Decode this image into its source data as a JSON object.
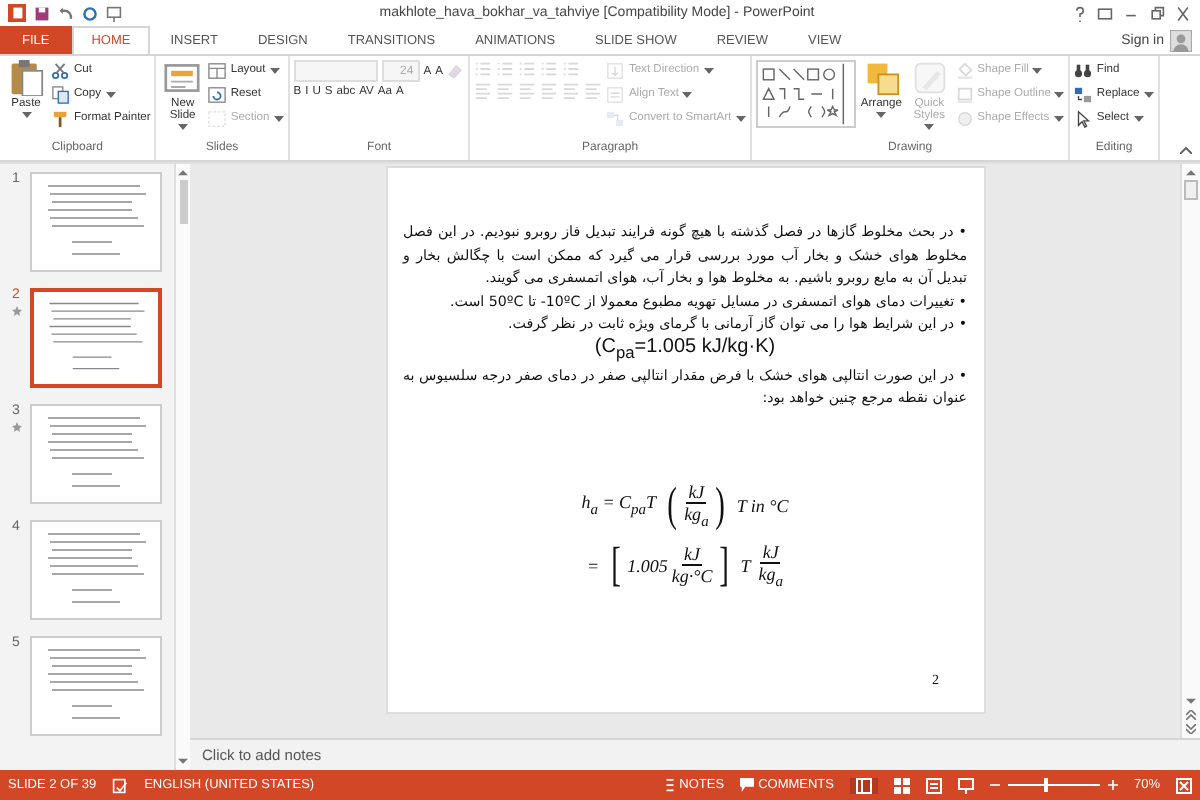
{
  "window": {
    "title": "makhlote_hava_bokhar_va_tahviye [Compatibility Mode] - PowerPoint",
    "sign_in": "Sign in"
  },
  "tabs": [
    {
      "label": "FILE",
      "kind": "file",
      "selected": false
    },
    {
      "label": "HOME",
      "kind": "tab",
      "selected": true
    },
    {
      "label": "INSERT",
      "kind": "tab",
      "selected": false
    },
    {
      "label": "DESIGN",
      "kind": "tab",
      "selected": false
    },
    {
      "label": "TRANSITIONS",
      "kind": "tab",
      "selected": false
    },
    {
      "label": "ANIMATIONS",
      "kind": "tab",
      "selected": false
    },
    {
      "label": "SLIDE SHOW",
      "kind": "tab",
      "selected": false
    },
    {
      "label": "REVIEW",
      "kind": "tab",
      "selected": false
    },
    {
      "label": "VIEW",
      "kind": "tab",
      "selected": false
    }
  ],
  "ribbon": {
    "groups": [
      {
        "label": "Clipboard",
        "columns": [
          [
            [
              {
                "kind": "large",
                "label": "Paste",
                "dropdown": true,
                "disabled": false
              }
            ]
          ],
          [
            [
              {
                "kind": "small",
                "label": "Cut",
                "dropdown": false,
                "disabled": false
              }
            ],
            [
              {
                "kind": "small",
                "label": "Copy",
                "dropdown": true,
                "disabled": false
              }
            ],
            [
              {
                "kind": "small",
                "label": "Format Painter",
                "dropdown": false,
                "disabled": false
              }
            ]
          ]
        ]
      },
      {
        "label": "Slides",
        "columns": [
          [
            [
              {
                "kind": "large",
                "label": "New Slide",
                "dropdown": true,
                "disabled": false
              }
            ]
          ],
          [
            [
              {
                "kind": "small",
                "label": "Layout",
                "dropdown": true,
                "disabled": false
              }
            ],
            [
              {
                "kind": "small",
                "label": "Reset",
                "dropdown": false,
                "disabled": false
              }
            ],
            [
              {
                "kind": "small",
                "label": "Section",
                "dropdown": true,
                "disabled": true
              }
            ]
          ]
        ]
      },
      {
        "label": "Font",
        "columns": [
          [
            [
              {
                "kind": "field",
                "disabled": true
              },
              {
                "kind": "field",
                "value": "24",
                "disabled": true
              },
              {
                "kind": "glyph",
                "label": "A",
                "disabled": true
              },
              {
                "kind": "glyph",
                "label": "A",
                "disabled": true
              },
              {
                "kind": "icon",
                "disabled": true
              }
            ],
            [
              {
                "kind": "glyph",
                "label": "B",
                "disabled": true
              },
              {
                "kind": "glyph",
                "label": "I",
                "disabled": true
              },
              {
                "kind": "glyph",
                "label": "U",
                "disabled": true
              },
              {
                "kind": "glyph",
                "label": "S",
                "disabled": true
              },
              {
                "kind": "glyph",
                "label": "abc",
                "disabled": true
              },
              {
                "kind": "glyph",
                "label": "AV",
                "disabled": true
              },
              {
                "kind": "glyph",
                "label": "Aa",
                "disabled": true
              },
              {
                "kind": "glyph",
                "label": "A",
                "disabled": true
              }
            ]
          ]
        ]
      },
      {
        "label": "Paragraph",
        "columns": [
          [
            [
              {
                "kind": "icon",
                "disabled": true
              },
              {
                "kind": "icon",
                "disabled": true
              },
              {
                "kind": "icon",
                "disabled": true
              },
              {
                "kind": "icon",
                "disabled": true
              },
              {
                "kind": "icon",
                "disabled": true
              }
            ],
            [
              {
                "kind": "icon",
                "disabled": true
              },
              {
                "kind": "icon",
                "disabled": true
              },
              {
                "kind": "icon",
                "disabled": true
              },
              {
                "kind": "icon",
                "disabled": true
              },
              {
                "kind": "icon",
                "disabled": true
              },
              {
                "kind": "icon",
                "disabled": true
              }
            ]
          ],
          [
            [
              {
                "kind": "small",
                "label": "Text Direction",
                "dropdown": true,
                "disabled": true
              }
            ],
            [
              {
                "kind": "small",
                "label": "Align Text",
                "dropdown": true,
                "disabled": true
              }
            ],
            [
              {
                "kind": "small",
                "label": "Convert to SmartArt",
                "dropdown": true,
                "disabled": true
              }
            ]
          ]
        ]
      },
      {
        "label": "Drawing",
        "columns": [
          [
            [
              {
                "kind": "gallery",
                "disabled": false
              }
            ]
          ],
          [
            [
              {
                "kind": "large",
                "label": "Arrange",
                "dropdown": true,
                "disabled": false
              }
            ]
          ],
          [
            [
              {
                "kind": "large",
                "label": "Quick Styles",
                "dropdown": true,
                "disabled": true
              }
            ]
          ],
          [
            [
              {
                "kind": "small",
                "label": "Shape Fill",
                "dropdown": true,
                "disabled": true
              }
            ],
            [
              {
                "kind": "small",
                "label": "Shape Outline",
                "dropdown": true,
                "disabled": true
              }
            ],
            [
              {
                "kind": "small",
                "label": "Shape Effects",
                "dropdown": true,
                "disabled": true
              }
            ]
          ]
        ]
      },
      {
        "label": "Editing",
        "columns": [
          [
            [
              {
                "kind": "small",
                "label": "Find",
                "dropdown": false,
                "disabled": false
              }
            ],
            [
              {
                "kind": "small",
                "label": "Replace",
                "dropdown": true,
                "disabled": false
              }
            ],
            [
              {
                "kind": "small",
                "label": "Select",
                "dropdown": true,
                "disabled": false
              }
            ]
          ]
        ]
      }
    ]
  },
  "thumbnails": [
    {
      "number": "1",
      "selected": false,
      "animated": false
    },
    {
      "number": "2",
      "selected": true,
      "animated": true
    },
    {
      "number": "3",
      "selected": false,
      "animated": true
    },
    {
      "number": "4",
      "selected": false,
      "animated": false
    },
    {
      "number": "5",
      "selected": false,
      "animated": false
    }
  ],
  "slide": {
    "paragraphs": [
      {
        "kind": "bullet",
        "text": "• در بحث مخلوط گازها در فصل گذشته با هیچ گونه فرایند تبدیل فاز روبرو نبودیم. در این فصل مخلوط هوای خشک و بخار آب مورد بررسی قرار می گیرد که ممکن است با چگالش بخار و تبدیل آن به مایع روبرو باشیم. به مخلوط هوا و بخار آب، هوای اتمسفری می گویند."
      },
      {
        "kind": "bullet",
        "text": "• تغییرات دمای هوای اتمسفری در مسایل تهویه مطبوع معمولا از ‎-10ºC‏ تا 50ºC است."
      },
      {
        "kind": "bullet",
        "text": "• در این شرایط هوا را می توان گاز آرمانی با گرمای ویژه ثابت در نظر گرفت."
      },
      {
        "kind": "center",
        "text": "(C$_{pa}$=1.005 kJ/kg·K)"
      },
      {
        "kind": "bullet",
        "text": "• در این صورت انتالپی هوای خشک با فرض مقدار انتالپی صفر در دمای صفر درجه سلسیوس به عنوان نقطه مرجع چنین خواهد بود:"
      }
    ],
    "equations": [
      {
        "parts": [
          {
            "kind": "text",
            "text": "h$_{a}$ = C$_{pa}$T"
          },
          {
            "kind": "group",
            "open": "(",
            "close": ")",
            "parts": [
              {
                "kind": "frac",
                "num": "kJ",
                "den": "kg$_{a}$"
              }
            ]
          },
          {
            "kind": "text",
            "text": "T in °C"
          }
        ]
      },
      {
        "parts": [
          {
            "kind": "text",
            "text": "="
          },
          {
            "kind": "group",
            "open": "[",
            "close": "]",
            "parts": [
              {
                "kind": "text",
                "text": "1.005"
              },
              {
                "kind": "frac",
                "num": "kJ",
                "den": "kg·°C"
              }
            ]
          },
          {
            "kind": "text",
            "text": "T"
          },
          {
            "kind": "frac",
            "num": "kJ",
            "den": "kg$_{a}$"
          }
        ]
      }
    ],
    "page_number": "2"
  },
  "notes": {
    "placeholder": "Click to add notes"
  },
  "status_bar": {
    "slide": "SLIDE 2 OF 39",
    "language": "ENGLISH (UNITED STATES)",
    "notes": "NOTES",
    "comments": "COMMENTS",
    "zoom": "70%",
    "zoom_level": {
      "level": 0.4
    }
  }
}
